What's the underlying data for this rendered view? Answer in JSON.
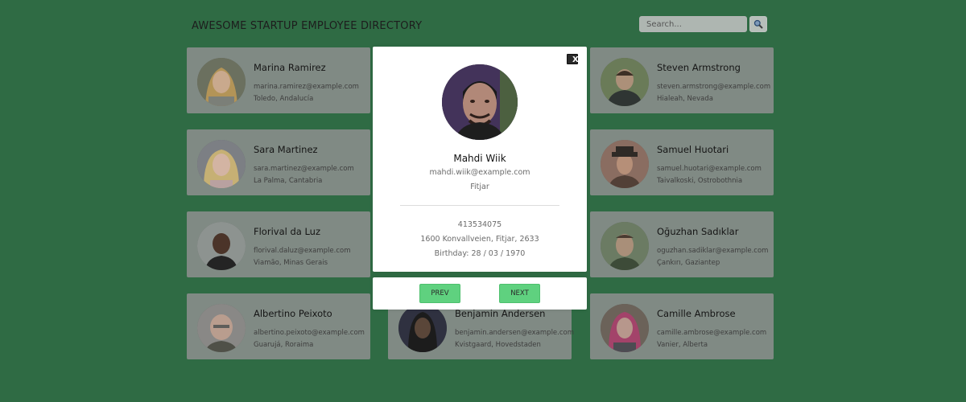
{
  "header": {
    "title": "AWESOME STARTUP EMPLOYEE DIRECTORY",
    "search_placeholder": "Search..."
  },
  "employees": [
    {
      "name": "Marina Ramirez",
      "email": "marina.ramirez@example.com",
      "location": "Toledo, Andalucía"
    },
    {
      "name": "Steven Armstrong",
      "email": "steven.armstrong@example.com",
      "location": "Hialeah, Nevada"
    },
    {
      "name": "Sara Martinez",
      "email": "sara.martinez@example.com",
      "location": "La Palma, Cantabria"
    },
    {
      "name": "Samuel Huotari",
      "email": "samuel.huotari@example.com",
      "location": "Taivalkoski, Ostrobothnia"
    },
    {
      "name": "Florival da Luz",
      "email": "florival.daluz@example.com",
      "location": "Viamão, Minas Gerais"
    },
    {
      "name": "Oğuzhan Sadıklar",
      "email": "oguzhan.sadiklar@example.com",
      "location": "Çankırı, Gaziantep"
    },
    {
      "name": "Albertino Peixoto",
      "email": "albertino.peixoto@example.com",
      "location": "Guarujá, Roraima"
    },
    {
      "name": "Benjamin Andersen",
      "email": "benjamin.andersen@example.com",
      "location": "Kvistgaard, Hovedstaden"
    },
    {
      "name": "Camille Ambrose",
      "email": "camille.ambrose@example.com",
      "location": "Vanier, Alberta"
    }
  ],
  "modal": {
    "close_label": "X",
    "name": "Mahdi Wiik",
    "email": "mahdi.wiik@example.com",
    "city": "Fitjar",
    "phone": "413534075",
    "address": "1600 Konvallveien, Fitjar, 2633",
    "birthday": "Birthday: 28 / 03 / 1970",
    "prev_label": "PREV",
    "next_label": "NEXT"
  },
  "colors": {
    "background": "#2f6b44",
    "card_dimmed": "#808a84",
    "button_green": "#5fd17f"
  },
  "icons": {
    "search": "magnifier-icon",
    "close": "close-icon"
  }
}
